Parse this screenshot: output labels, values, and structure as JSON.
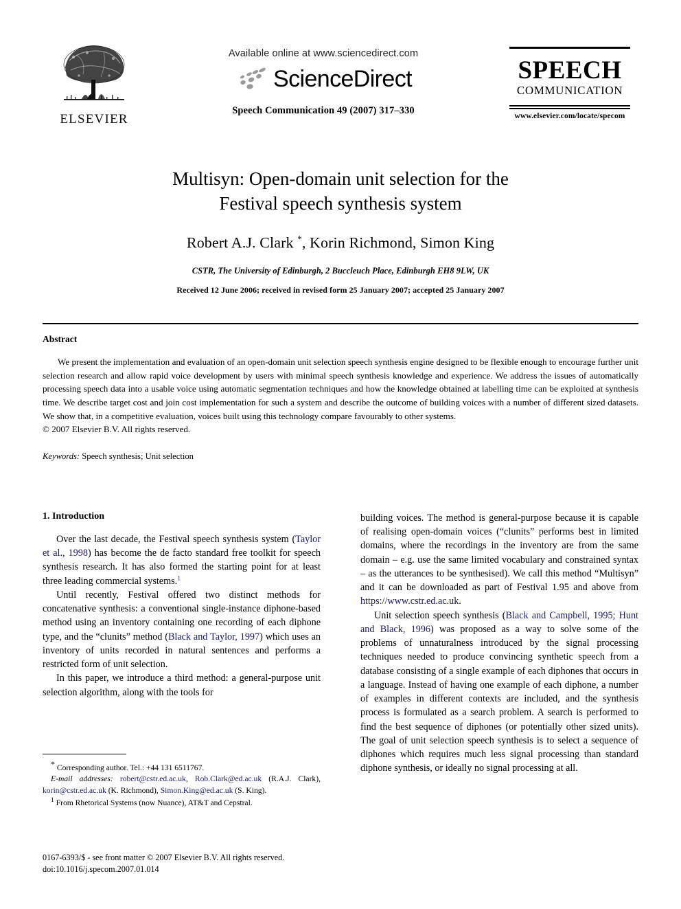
{
  "masthead": {
    "publisher_name": "ELSEVIER",
    "available_online": "Available online at www.sciencedirect.com",
    "sciencedirect_wordmark": "ScienceDirect",
    "journal_reference": "Speech Communication 49 (2007) 317–330",
    "journal_title_main": "SPEECH",
    "journal_title_sub": "COMMUNICATION",
    "journal_url": "www.elsevier.com/locate/specom"
  },
  "title_block": {
    "title_line_1": "Multisyn: Open-domain unit selection for the",
    "title_line_2": "Festival speech synthesis system",
    "authors": "Robert A.J. Clark ",
    "authors_rest": ", Korin Richmond, Simon King",
    "author_marker": "*",
    "affiliation": "CSTR, The University of Edinburgh, 2 Buccleuch Place, Edinburgh EH8 9LW, UK",
    "received": "Received 12 June 2006; received in revised form 25 January 2007; accepted 25 January 2007"
  },
  "abstract": {
    "heading": "Abstract",
    "body": "We present the implementation and evaluation of an open-domain unit selection speech synthesis engine designed to be flexible enough to encourage further unit selection research and allow rapid voice development by users with minimal speech synthesis knowledge and experience. We address the issues of automatically processing speech data into a usable voice using automatic segmentation techniques and how the knowledge obtained at labelling time can be exploited at synthesis time. We describe target cost and join cost implementation for such a system and describe the outcome of building voices with a number of different sized datasets. We show that, in a competitive evaluation, voices built using this technology compare favourably to other systems.",
    "copyright": "© 2007 Elsevier B.V. All rights reserved.",
    "keywords_label": "Keywords:",
    "keywords_value": "Speech synthesis; Unit selection"
  },
  "body": {
    "section_1_heading": "1. Introduction",
    "p1_a": "Over the last decade, the Festival speech synthesis system (",
    "p1_ref1": "Taylor et al., 1998",
    "p1_b": ") has become the de facto standard free toolkit for speech synthesis research. It has also formed the starting point for at least three leading commercial systems.",
    "p1_fnmark": "1",
    "p2_a": "Until recently, Festival offered two distinct methods for concatenative synthesis: a conventional single-instance diphone-based method using an inventory containing one recording of each diphone type, and the “clunits” method (",
    "p2_ref1": "Black and Taylor, 1997",
    "p2_b": ") which uses an inventory of units recorded in natural sentences and performs a restricted form of unit selection.",
    "p3": "In this paper, we introduce a third method: a general-purpose unit selection algorithm, along with the tools for",
    "p4_a": "building voices. The method is general-purpose because it is capable of realising open-domain voices (“clunits” performs best in limited domains, where the recordings in the inventory are from the same domain – e.g. use the same limited vocabulary and constrained syntax – as the utterances to be synthesised). We call this method “Multisyn” and it can be downloaded as part of Festival 1.95 and above from ",
    "p4_link": "https://www.cstr.ed.ac.uk",
    "p4_b": ".",
    "p5_a": "Unit selection speech synthesis (",
    "p5_ref1": "Black and Campbell, 1995; Hunt and Black, 1996",
    "p5_b": ") was proposed as a way to solve some of the problems of unnaturalness introduced by the signal processing techniques needed to produce convincing synthetic speech from a database consisting of a single example of each diphones that occurs in a language. Instead of having one example of each diphone, a number of examples in different contexts are included, and the synthesis process is formulated as a search problem. A search is performed to find the best sequence of diphones (or potentially other sized units). The goal of unit selection speech synthesis is to select a sequence of diphones which requires much less signal processing than standard diphone synthesis, or ideally no signal processing at all."
  },
  "footnotes": {
    "corresponding_marker": "*",
    "corresponding_text": "Corresponding author. Tel.: +44 131 6511767.",
    "email_label": "E-mail addresses:",
    "email_1": "robert@cstr.ed.ac.uk",
    "email_2": "Rob.Clark@ed.ac.uk",
    "email_1_owner": "(R.A.J. Clark),",
    "email_3": "korin@cstr.ed.ac.uk",
    "email_3_owner": "(K. Richmond),",
    "email_4": "Simon.King@ed.ac.uk",
    "email_4_owner": "(S. King).",
    "fn1_marker": "1",
    "fn1_text": "From Rhetorical Systems (now Nuance), AT&T and Cepstral."
  },
  "imprint": {
    "line_1": "0167-6393/$ - see front matter © 2007 Elsevier B.V. All rights reserved.",
    "line_2": "doi:10.1016/j.specom.2007.01.014"
  },
  "colors": {
    "link": "#191970",
    "text": "#000000",
    "background": "#ffffff"
  }
}
